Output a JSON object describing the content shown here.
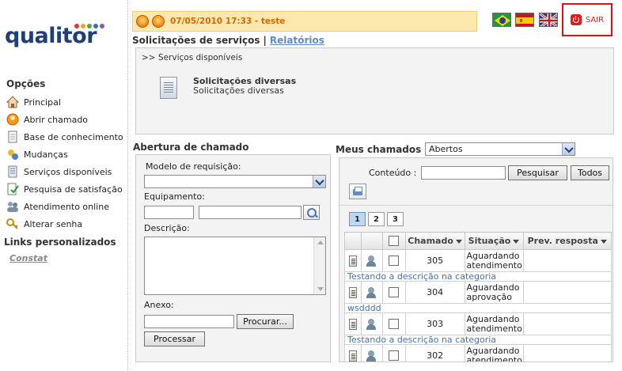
{
  "brand": {
    "logo_text": "qualitor",
    "dot_colors": [
      "#e23a2a",
      "#f0a81b",
      "#5aa632",
      "#2e6fb7",
      "#8e58a8"
    ]
  },
  "header": {
    "user_info": "07/05/2010 17:33 - teste",
    "logout_label": "SAIR",
    "flags": [
      "brazil-flag-icon",
      "spain-flag-icon",
      "uk-flag-icon"
    ]
  },
  "tabs": {
    "services": "Solicitações de serviços",
    "separator": "|",
    "reports": "Relatórios"
  },
  "sidebar": {
    "options_title": "Opções",
    "items": [
      {
        "label": "Principal",
        "icon": "home-icon"
      },
      {
        "label": "Abrir chamado",
        "icon": "support-icon"
      },
      {
        "label": "Base de conhecimento",
        "icon": "document-icon"
      },
      {
        "label": "Mudanças",
        "icon": "changes-icon"
      },
      {
        "label": "Serviços disponíveis",
        "icon": "services-icon"
      },
      {
        "label": "Pesquisa de satisfação",
        "icon": "survey-icon"
      },
      {
        "label": "Atendimento online",
        "icon": "online-support-icon"
      },
      {
        "label": "Alterar senha",
        "icon": "key-icon"
      }
    ],
    "links_title": "Links personalizados",
    "custom_link": "Constat"
  },
  "services_panel": {
    "breadcrumb": ">> Serviços disponíveis",
    "service_title": "Solicitações diversas",
    "service_desc": "Solicitações diversas"
  },
  "open_ticket": {
    "title": "Abertura de chamado",
    "model_label": "Modelo de requisição:",
    "model_value": "",
    "equipment_label": "Equipamento:",
    "equipment_code": "",
    "equipment_name": "",
    "description_label": "Descrição:",
    "description_value": "",
    "attachment_label": "Anexo:",
    "attachment_value": "",
    "browse_button": "Procurar...",
    "process_button": "Processar"
  },
  "my_tickets": {
    "title": "Meus chamados :",
    "filter_value": "Abertos",
    "search_label": "Conteúdo :",
    "search_value": "",
    "search_button": "Pesquisar",
    "all_button": "Todos",
    "pages": [
      "1",
      "2",
      "3"
    ],
    "active_page": "1",
    "columns": [
      "Chamado",
      "Situação",
      "Prev. resposta"
    ],
    "rows": [
      {
        "id": "305",
        "status_line1": "Aguardando",
        "status_line2": "atendimento",
        "forecast": "",
        "description": "Testando a descrição na categoria"
      },
      {
        "id": "304",
        "status_line1": "Aguardando",
        "status_line2": "aprovação",
        "forecast": "",
        "description": "wsdddd"
      },
      {
        "id": "303",
        "status_line1": "Aguardando",
        "status_line2": "atendimento",
        "forecast": "",
        "description": "Testando a descrição na categoria"
      },
      {
        "id": "302",
        "status_line1": "Aguardando",
        "status_line2": "atendimento",
        "forecast": "",
        "description": ""
      }
    ]
  }
}
